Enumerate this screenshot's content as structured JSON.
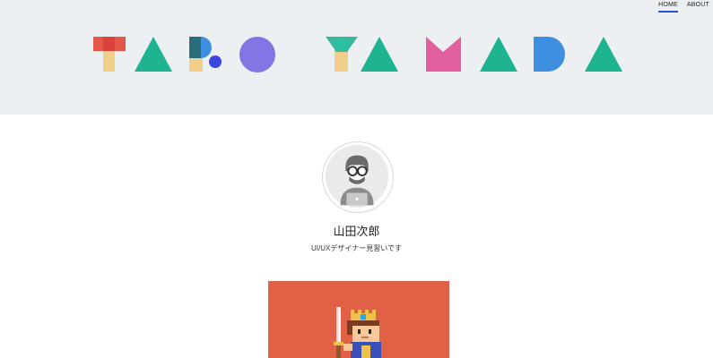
{
  "nav": {
    "items": [
      {
        "label": "HOME",
        "active": true
      },
      {
        "label": "ABOUT",
        "active": false
      }
    ]
  },
  "hero": {
    "logo_text": "TARO YAMADA",
    "colors": {
      "background": "#edf0f2",
      "teal": "#1fb491",
      "red": "#e24a3c",
      "yellow": "#f1cf8a",
      "purple": "#8375e3",
      "blue_dot": "#3a45e0",
      "pink": "#e2609e",
      "blue": "#3f8fe0"
    }
  },
  "profile": {
    "name": "山田次郎",
    "bio": "UI/UXデザイナー見習いです",
    "avatar_icon": "person-with-glasses-laptop-icon"
  },
  "featured": {
    "background": "#e06146",
    "icon": "pixel-knight-icon"
  }
}
